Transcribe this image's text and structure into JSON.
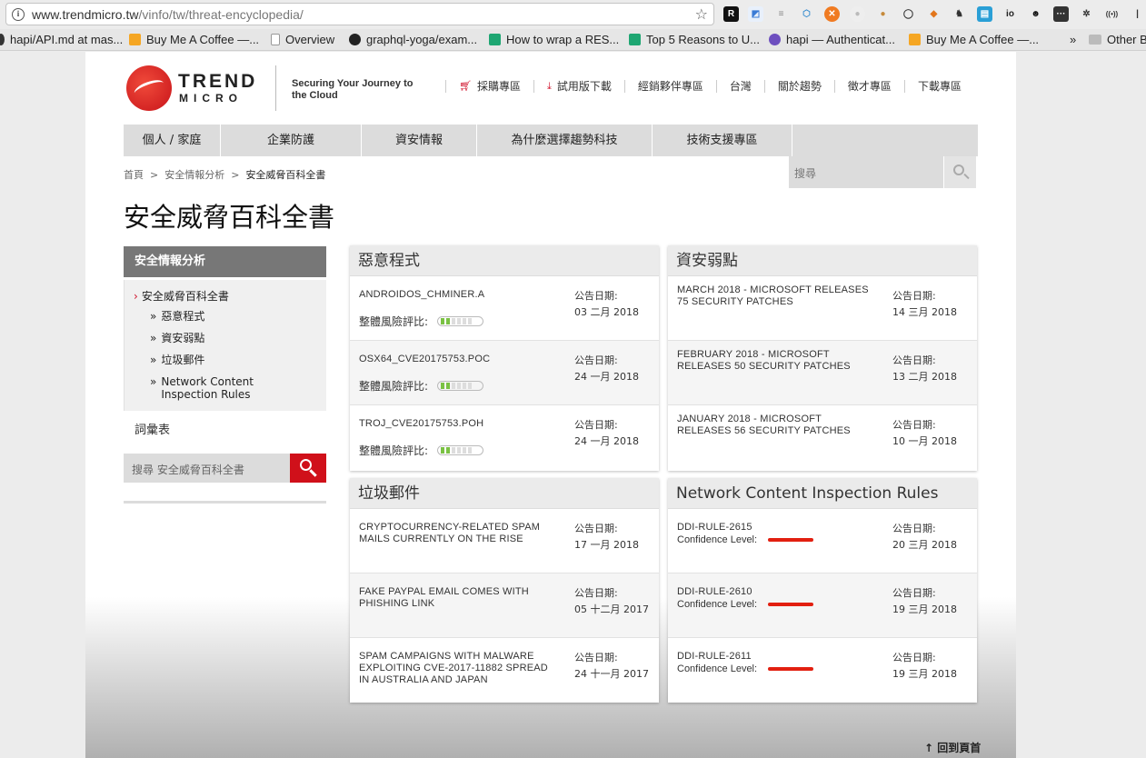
{
  "browser": {
    "url_host": "www.trendmicro.tw",
    "url_path": "/vinfo/tw/threat-encyclopedia/",
    "bookmarks": [
      {
        "label": "hapi/API.md at mas..."
      },
      {
        "label": "Buy Me A Coffee —..."
      },
      {
        "label": "Overview"
      },
      {
        "label": "graphql-yoga/exam..."
      },
      {
        "label": "How to wrap a RES..."
      },
      {
        "label": "Top 5 Reasons to U..."
      },
      {
        "label": "hapi — Authenticat..."
      },
      {
        "label": "Buy Me A Coffee —..."
      }
    ],
    "bookmarks_more": "»",
    "other_bookmarks": "Other B"
  },
  "header": {
    "logo_line1": "TREND",
    "logo_line2": "MICRO",
    "tagline": "Securing Your Journey to the Cloud",
    "top_links": [
      "採購專區",
      "試用版下載",
      "經銷夥伴專區",
      "台灣",
      "關於趨勢",
      "徵才專區",
      "下載專區"
    ]
  },
  "nav": {
    "items": [
      "個人 / 家庭",
      "企業防護",
      "資安情報",
      "為什麼選擇趨勢科技",
      "技術支援專區"
    ]
  },
  "breadcrumb": {
    "home": "首頁",
    "sep": ">",
    "section": "安全情報分析",
    "current": "安全威脅百科全書"
  },
  "search": {
    "placeholder": "搜尋"
  },
  "page_title": "安全威脅百科全書",
  "sidebar": {
    "heading": "安全情報分析",
    "main_item": "安全威脅百科全書",
    "arrow": "›",
    "sub_marker": "»",
    "sub_items": [
      "惡意程式",
      "資安弱點",
      "垃圾郵件",
      "Network Content Inspection Rules"
    ],
    "glossary": "詞彙表",
    "search_placeholder": "搜尋 安全威脅百科全書"
  },
  "panels": {
    "malware": {
      "title": "惡意程式",
      "risk_label": "整體風險評比:",
      "date_label": "公告日期:",
      "rows": [
        {
          "name": "ANDROIDOS_CHMINER.A",
          "date": "03 二月 2018",
          "risk_level": 2,
          "risk_max": 6
        },
        {
          "name": "OSX64_CVE20175753.POC",
          "date": "24 一月 2018",
          "risk_level": 2,
          "risk_max": 6
        },
        {
          "name": "TROJ_CVE20175753.POH",
          "date": "24 一月 2018",
          "risk_level": 2,
          "risk_max": 6
        }
      ]
    },
    "vuln": {
      "title": "資安弱點",
      "date_label": "公告日期:",
      "rows": [
        {
          "name": "MARCH 2018 - MICROSOFT RELEASES 75 SECURITY PATCHES",
          "date": "14 三月 2018"
        },
        {
          "name": "FEBRUARY 2018 - MICROSOFT RELEASES 50 SECURITY PATCHES",
          "date": "13 二月 2018"
        },
        {
          "name": "JANUARY 2018 - MICROSOFT RELEASES 56 SECURITY PATCHES",
          "date": "10 一月 2018"
        }
      ]
    },
    "spam": {
      "title": "垃圾郵件",
      "date_label": "公告日期:",
      "rows": [
        {
          "name": "CRYPTOCURRENCY-RELATED SPAM MAILS CURRENTLY ON THE RISE",
          "date": "17 一月 2018"
        },
        {
          "name": "FAKE PAYPAL EMAIL COMES WITH PHISHING LINK",
          "date": "05 十二月 2017"
        },
        {
          "name": "SPAM CAMPAIGNS WITH MALWARE EXPLOITING CVE-2017-11882 SPREAD IN AUSTRALIA AND JAPAN",
          "date": "24 十一月 2017"
        }
      ]
    },
    "ncir": {
      "title": "Network Content Inspection Rules",
      "date_label": "公告日期:",
      "confidence_label": "Confidence Level:",
      "rows": [
        {
          "name": "DDI-RULE-2615",
          "date": "20 三月 2018"
        },
        {
          "name": "DDI-RULE-2610",
          "date": "19 三月 2018"
        },
        {
          "name": "DDI-RULE-2611",
          "date": "19 三月 2018"
        }
      ]
    }
  },
  "back_to_top": "↑ 回到頁首",
  "colors": {
    "brand_red": "#d0101a",
    "risk_green": "#7ac143",
    "confidence_red": "#e21f10"
  }
}
